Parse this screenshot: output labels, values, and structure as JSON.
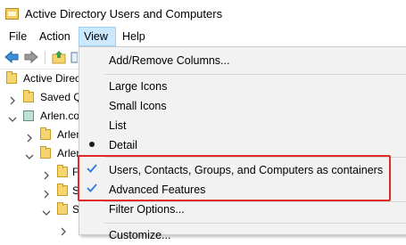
{
  "window": {
    "title": "Active Directory Users and Computers"
  },
  "menubar": {
    "items": [
      "File",
      "Action",
      "View",
      "Help"
    ],
    "open_menu": "View"
  },
  "tree": {
    "root_label": "Active Directory",
    "saved_queries_label": "Saved Q",
    "domain_label": "Arlen.co",
    "child_1": "Arlen",
    "child_2": "Arlen",
    "folder_a": "F",
    "folder_b": "S",
    "folder_c": "S"
  },
  "view_menu": {
    "add_remove_columns": "Add/Remove Columns...",
    "large_icons": "Large Icons",
    "small_icons": "Small Icons",
    "list": "List",
    "detail": "Detail",
    "users_containers": "Users, Contacts, Groups, and Computers as containers",
    "advanced_features": "Advanced Features",
    "filter_options": "Filter Options...",
    "customize": "Customize..."
  },
  "state": {
    "selected_view": "Detail",
    "users_containers_checked": true,
    "advanced_features_checked": true
  },
  "colors": {
    "menu_open_bg": "#cce8ff",
    "highlight": "#e02a2a",
    "check": "#2b79d8"
  }
}
